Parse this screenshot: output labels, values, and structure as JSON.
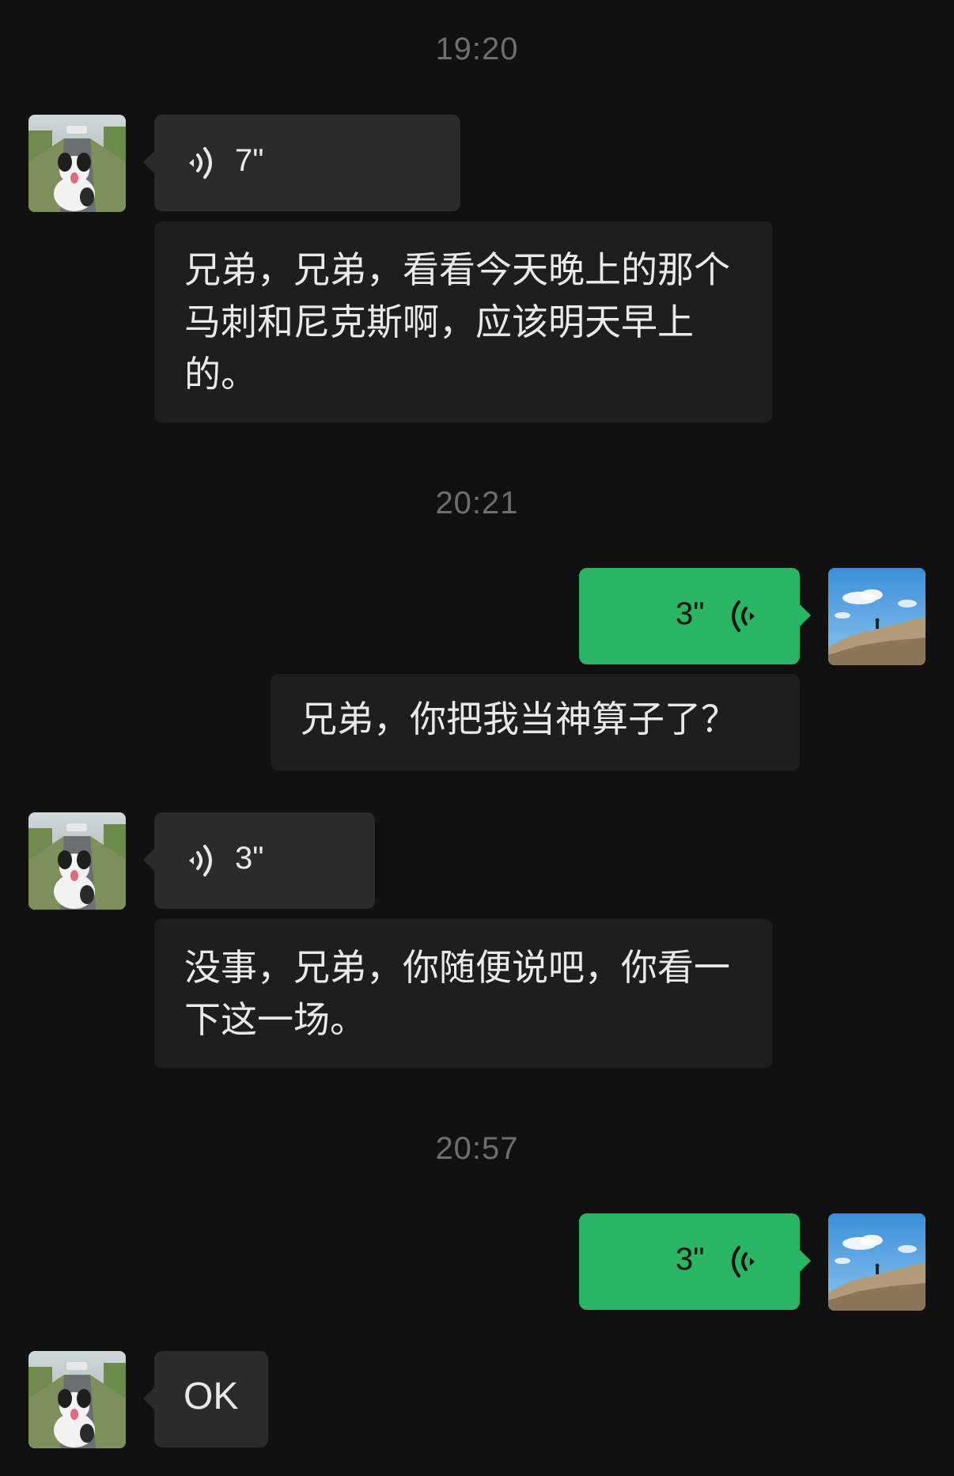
{
  "timestamps": [
    "19:20",
    "20:21",
    "20:57"
  ],
  "messages": [
    {
      "from": "other",
      "type": "voice",
      "duration": "7\""
    },
    {
      "from": "other",
      "type": "text",
      "text": "兄弟，兄弟，看看今天晚上的那个马刺和尼克斯啊，应该明天早上的。"
    },
    {
      "from": "me",
      "type": "voice",
      "duration": "3\""
    },
    {
      "from": "me",
      "type": "text",
      "text": "兄弟，你把我当神算子了？"
    },
    {
      "from": "other",
      "type": "voice",
      "duration": "3\""
    },
    {
      "from": "other",
      "type": "text",
      "text": "没事，兄弟，你随便说吧，你看一下这一场。"
    },
    {
      "from": "me",
      "type": "voice",
      "duration": "3\""
    },
    {
      "from": "other",
      "type": "text",
      "text": "OK"
    }
  ],
  "colors": {
    "background": "#111111",
    "incoming_bubble": "#2b2b2b",
    "outgoing_bubble": "#29b563",
    "timestamp": "#6e6e6e"
  },
  "icons": {
    "other_avatar": "dog-avatar",
    "my_avatar": "mountain-sky-avatar",
    "voice": "sound-wave-icon"
  }
}
